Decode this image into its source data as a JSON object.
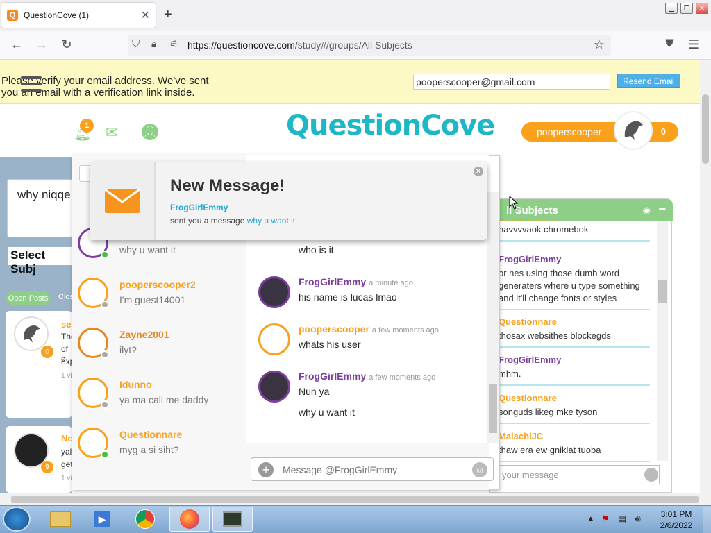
{
  "browser": {
    "tab_title": "QuestionCove (1)",
    "url_host": "https://questioncove.com",
    "url_path": "/study#/groups/All Subjects"
  },
  "verify": {
    "message": "Please verify your email address. We've sent you an email with a verification link inside.",
    "email_value": "pooperscooper@gmail.com",
    "resend_label": "Resend Email"
  },
  "header": {
    "logo": "QuestionCove",
    "notif_count": "1",
    "username": "pooperscooper",
    "score": "0"
  },
  "left": {
    "question_text": "why niqqe",
    "select_subject": "Select Subj",
    "open_posts": "Open Posts",
    "closed_posts": "Clos",
    "post1_author": "sev",
    "post1_lines": [
      "The",
      "of c",
      "exp"
    ],
    "post1_meta": "1 vi",
    "post1_badge": "0",
    "post2_author": "No",
    "post2_lines": [
      "yal",
      "get"
    ],
    "post2_meta": "1 vi",
    "post2_badge": "9"
  },
  "conversations": [
    {
      "name": "",
      "preview": "why u want it",
      "color": "#7a3e9d",
      "status": "online"
    },
    {
      "name": "pooperscooper2",
      "preview": "I'm guest14001",
      "color": "#f9a11b",
      "status": "offline"
    },
    {
      "name": "Zayne2001",
      "preview": "ilyt?",
      "color": "#e8871e",
      "status": "offline"
    },
    {
      "name": "Idunno",
      "preview": "ya ma call me daddy",
      "color": "#f9a11b",
      "status": "offline"
    },
    {
      "name": "Questionnare",
      "preview": "myg a si siht?",
      "color": "#f9a11b",
      "status": "online"
    }
  ],
  "messages": [
    {
      "author": "",
      "time": "",
      "text": "who is it"
    },
    {
      "author": "FrogGirlEmmy",
      "time": "a minute ago",
      "text": "his name is lucas lmao",
      "color": "#7a3e9d"
    },
    {
      "author": "pooperscooper",
      "time": "a few moments ago",
      "text": "whats his user",
      "color": "#f9a11b"
    },
    {
      "author": "FrogGirlEmmy",
      "time": "a few moments ago",
      "text": "Nun ya",
      "color": "#7a3e9d"
    },
    {
      "author": "",
      "time": "",
      "text": "why u want it"
    }
  ],
  "composer": {
    "placeholder": "Message @FrogGirlEmmy"
  },
  "notification": {
    "title": "New Message!",
    "from": "FrogGirlEmmy",
    "body_prefix": "sent you a message",
    "body_link": "why u want it"
  },
  "subjects": {
    "header": "ll Subjects",
    "items": [
      {
        "name": "Questionnare",
        "text": "havvvvaok chromebok",
        "color": "#f9a11b"
      },
      {
        "name": "FrogGirlEmmy",
        "text": "or hes using those dumb word generaters where u type something and it'll change fonts or styles",
        "color": "#7a3e9d"
      },
      {
        "name": "Questionnare",
        "text": "thosax websithes blockegds",
        "color": "#f9a11b"
      },
      {
        "name": "FrogGirlEmmy",
        "text": "mhm.",
        "color": "#7a3e9d"
      },
      {
        "name": "Questionnare",
        "text": "songuds likeg mke tyson",
        "color": "#f9a11b"
      },
      {
        "name": "MalachiJC",
        "text": "thaw era ew gniklat tuoba",
        "color": "#f9a11b"
      }
    ],
    "input_placeholder": "your message"
  },
  "taskbar": {
    "time": "3:01 PM",
    "date": "2/6/2022"
  }
}
